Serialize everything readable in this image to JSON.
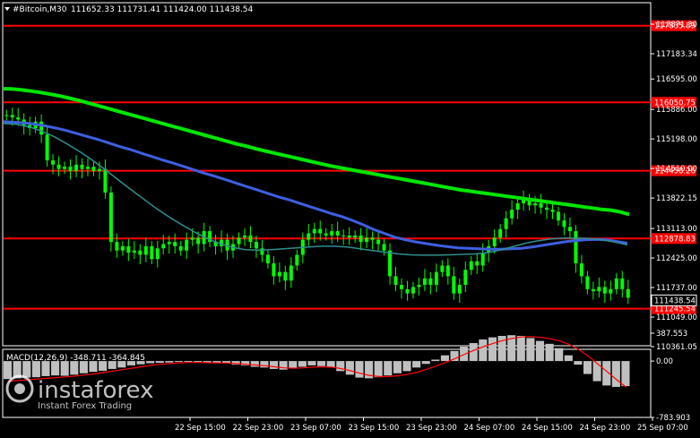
{
  "header": {
    "symbol": "#Bitcoin,M30",
    "ohlc": "111652.33 111731.41 111424.00 111438.54"
  },
  "watermark": {
    "brand": "instaforex",
    "tagline": "Instant Forex Trading"
  },
  "colors": {
    "background": "#000000",
    "candle": "#00ff00",
    "ma_slow": "#00e600",
    "ma_mid": "#3f5fe0",
    "ma_fast": "#2e8f8f",
    "level": "#ff0000",
    "macd_hist": "#c0c0c0",
    "macd_signal": "#ff0000",
    "price_tag": "#000000"
  },
  "chart_data": [
    {
      "type": "line",
      "title": "#Bitcoin,M30",
      "yticks": [
        "117871.30",
        "117183.34",
        "116595.00",
        "115886.00",
        "115198.00",
        "114510.00",
        "113822.15",
        "113113.00",
        "112425.00",
        "111737.00",
        "111049.00",
        "110361.05"
      ],
      "ylim": [
        110361.05,
        117871.3
      ],
      "xticks": [
        "22 Sep 15:00",
        "22 Sep 23:00",
        "23 Sep 07:00",
        "23 Sep 15:00",
        "23 Sep 23:00",
        "24 Sep 07:00",
        "24 Sep 15:00",
        "24 Sep 23:00",
        "25 Sep 07:00"
      ],
      "current_price": {
        "label": "111438.54",
        "value": 111438.54
      },
      "levels": [
        {
          "label": "117835.89",
          "value": 117835.89
        },
        {
          "label": "116050.75",
          "value": 116050.75
        },
        {
          "label": "114458.26",
          "value": 114458.26
        },
        {
          "label": "112878.83",
          "value": 112878.83
        },
        {
          "label": "111245.54",
          "value": 111245.54
        }
      ],
      "close_series": [
        115756,
        115700,
        115650,
        115520,
        115450,
        115600,
        115300,
        114700,
        114600,
        114500,
        114550,
        114450,
        114600,
        114500,
        114550,
        114450,
        114500,
        113950,
        112800,
        112600,
        112700,
        112550,
        112600,
        112500,
        112700,
        112400,
        112650,
        112750,
        112800,
        112700,
        112600,
        112850,
        112900,
        112750,
        113050,
        112800,
        112700,
        112850,
        112600,
        112750,
        112900,
        112950,
        112800,
        112650,
        112500,
        112300,
        112000,
        112100,
        111900,
        112250,
        112500,
        112850,
        113000,
        113100,
        113000,
        112950,
        113050,
        112950,
        112950,
        112900,
        112950,
        112800,
        112900,
        112850,
        112750,
        112600,
        112000,
        111800,
        111700,
        111600,
        111750,
        111800,
        111950,
        111800,
        112100,
        112250,
        112000,
        111600,
        111800,
        112150,
        112350,
        112250,
        112550,
        112700,
        112900,
        113100,
        113350,
        113550,
        113700,
        113800,
        113650,
        113700,
        113600,
        113550,
        113500,
        113300,
        113150,
        113050,
        112300,
        112000,
        111700,
        111650,
        111750,
        111600,
        111700,
        111950,
        111700,
        111500
      ],
      "series": [
        {
          "name": "",
          "values": [
            116370,
            116360,
            116340,
            116310,
            116280,
            116240,
            116200,
            116150,
            116100,
            116040,
            115980,
            115920,
            115860,
            115800,
            115740,
            115680,
            115620,
            115560,
            115500,
            115440,
            115380,
            115320,
            115260,
            115200,
            115140,
            115080,
            115030,
            114970,
            114920,
            114870,
            114820,
            114770,
            114720,
            114670,
            114620,
            114570,
            114530,
            114490,
            114450,
            114410,
            114370,
            114330,
            114290,
            114250,
            114210,
            114170,
            114130,
            114090,
            114050,
            114010,
            113980,
            113950,
            113920,
            113890,
            113860,
            113830,
            113800,
            113770,
            113740,
            113710,
            113680,
            113650,
            113620,
            113590,
            113560,
            113540,
            113500,
            113440
          ]
        },
        {
          "name": "",
          "values": [
            115600,
            115590,
            115570,
            115540,
            115500,
            115450,
            115390,
            115320,
            115250,
            115180,
            115100,
            115020,
            114950,
            114870,
            114790,
            114710,
            114640,
            114560,
            114480,
            114400,
            114330,
            114250,
            114170,
            114090,
            114010,
            113930,
            113850,
            113780,
            113700,
            113620,
            113540,
            113460,
            113390,
            113300,
            113200,
            113090,
            113000,
            112910,
            112850,
            112800,
            112760,
            112720,
            112690,
            112660,
            112650,
            112640,
            112630,
            112630,
            112640,
            112650,
            112680,
            112720,
            112760,
            112800,
            112830,
            112850,
            112860,
            112850,
            112810,
            112770
          ]
        },
        {
          "name": "",
          "values": [
            115560,
            115540,
            115480,
            115380,
            115250,
            115080,
            114900,
            114700,
            114480,
            114250,
            114020,
            113800,
            113580,
            113380,
            113200,
            113030,
            112880,
            112760,
            112670,
            112620,
            112610,
            112620,
            112640,
            112660,
            112680,
            112700,
            112700,
            112680,
            112640,
            112600,
            112560,
            112520,
            112500,
            112490,
            112490,
            112500,
            112510,
            112520,
            112550,
            112610,
            112690,
            112770,
            112830,
            112870,
            112890,
            112890,
            112880,
            112850,
            112800,
            112730
          ]
        }
      ]
    },
    {
      "type": "bar",
      "title": "MACD(12,26,9) -348.711 -364.845",
      "yticks": [
        "387.553",
        "0.00",
        "-783.903"
      ],
      "ylim": [
        -783.903,
        387.553
      ],
      "series": [
        {
          "name": "MACD",
          "values": [
            -250,
            -240,
            -230,
            -225,
            -210,
            -200,
            -205,
            -190,
            -170,
            -150,
            -135,
            -110,
            -90,
            -60,
            -45,
            -30,
            -25,
            -20,
            -10,
            -5,
            -15,
            -20,
            -25,
            -30,
            -50,
            -60,
            -80,
            -90,
            -110,
            -120,
            -100,
            -80,
            -60,
            -70,
            -90,
            -140,
            -190,
            -230,
            -240,
            -225,
            -200,
            -170,
            -140,
            -90,
            -40,
            20,
            80,
            140,
            200,
            250,
            300,
            330,
            350,
            360,
            350,
            320,
            280,
            240,
            180,
            80,
            -50,
            -180,
            -280,
            -340,
            -360,
            -349
          ]
        },
        {
          "name": "Signal",
          "values": [
            -280,
            -270,
            -260,
            -250,
            -240,
            -230,
            -220,
            -210,
            -195,
            -180,
            -160,
            -140,
            -120,
            -100,
            -80,
            -60,
            -45,
            -35,
            -25,
            -20,
            -20,
            -22,
            -25,
            -28,
            -35,
            -45,
            -55,
            -65,
            -80,
            -95,
            -100,
            -95,
            -85,
            -80,
            -85,
            -105,
            -135,
            -170,
            -200,
            -215,
            -215,
            -205,
            -185,
            -155,
            -115,
            -70,
            -20,
            35,
            95,
            150,
            200,
            245,
            285,
            315,
            335,
            340,
            330,
            310,
            280,
            230,
            160,
            70,
            -40,
            -150,
            -260,
            -365
          ]
        }
      ]
    }
  ]
}
